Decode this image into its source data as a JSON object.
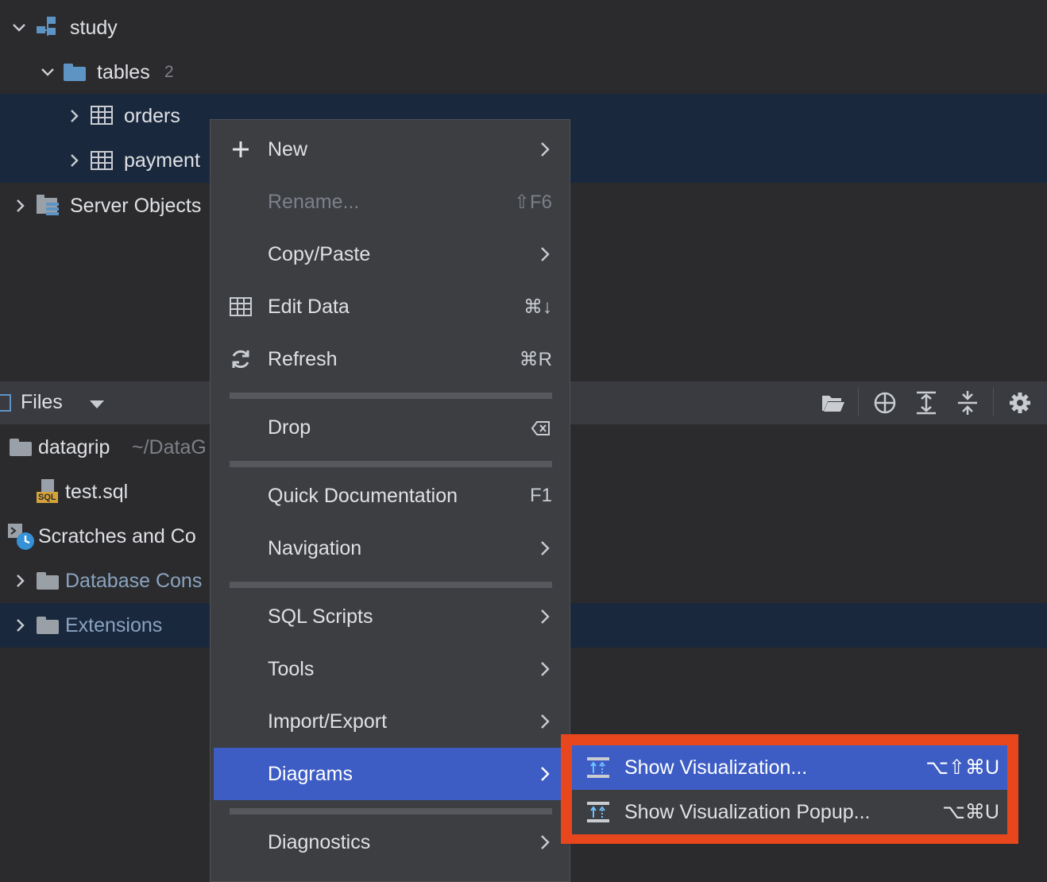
{
  "tree": {
    "study": "study",
    "tables": {
      "label": "tables",
      "count": "2"
    },
    "orders": "orders",
    "payment": "payment",
    "server_objects": "Server Objects"
  },
  "files_panel": {
    "title": "Files",
    "datagrip": {
      "label": "datagrip",
      "path": "~/DataG"
    },
    "test_sql": "test.sql",
    "sql_badge": "SQL",
    "scratches": "Scratches and Co",
    "database_cons": "Database Cons",
    "extensions": "Extensions"
  },
  "context_menu": {
    "items": [
      {
        "label": "New",
        "icon": "plus-icon",
        "submenu": true
      },
      {
        "label": "Rename...",
        "shortcut": "⇧F6",
        "disabled": true
      },
      {
        "label": "Copy/Paste",
        "submenu": true
      },
      {
        "label": "Edit Data",
        "icon": "table-icon",
        "shortcut": "⌘↓"
      },
      {
        "label": "Refresh",
        "icon": "refresh-icon",
        "shortcut": "⌘R"
      },
      {
        "label": "Drop",
        "shortcut_icon": "delete-key-icon"
      },
      {
        "label": "Quick Documentation",
        "shortcut": "F1"
      },
      {
        "label": "Navigation",
        "submenu": true
      },
      {
        "label": "SQL Scripts",
        "submenu": true
      },
      {
        "label": "Tools",
        "submenu": true
      },
      {
        "label": "Import/Export",
        "submenu": true
      },
      {
        "label": "Diagrams",
        "submenu": true,
        "active": true
      },
      {
        "label": "Diagnostics",
        "submenu": true
      }
    ]
  },
  "submenu": {
    "items": [
      {
        "label": "Show Visualization...",
        "shortcut": "⌥⇧⌘U",
        "active": true,
        "icon": "diagram-icon"
      },
      {
        "label": "Show Visualization Popup...",
        "shortcut": "⌥⌘U",
        "icon": "diagram-icon"
      }
    ]
  },
  "colors": {
    "background": "#2b2b2d",
    "selection_row": "#19283d",
    "menu_bg": "#3c3e42",
    "active_item": "#3d5dc5",
    "highlight_border": "#e8461d",
    "folder": "#5e94c4"
  }
}
